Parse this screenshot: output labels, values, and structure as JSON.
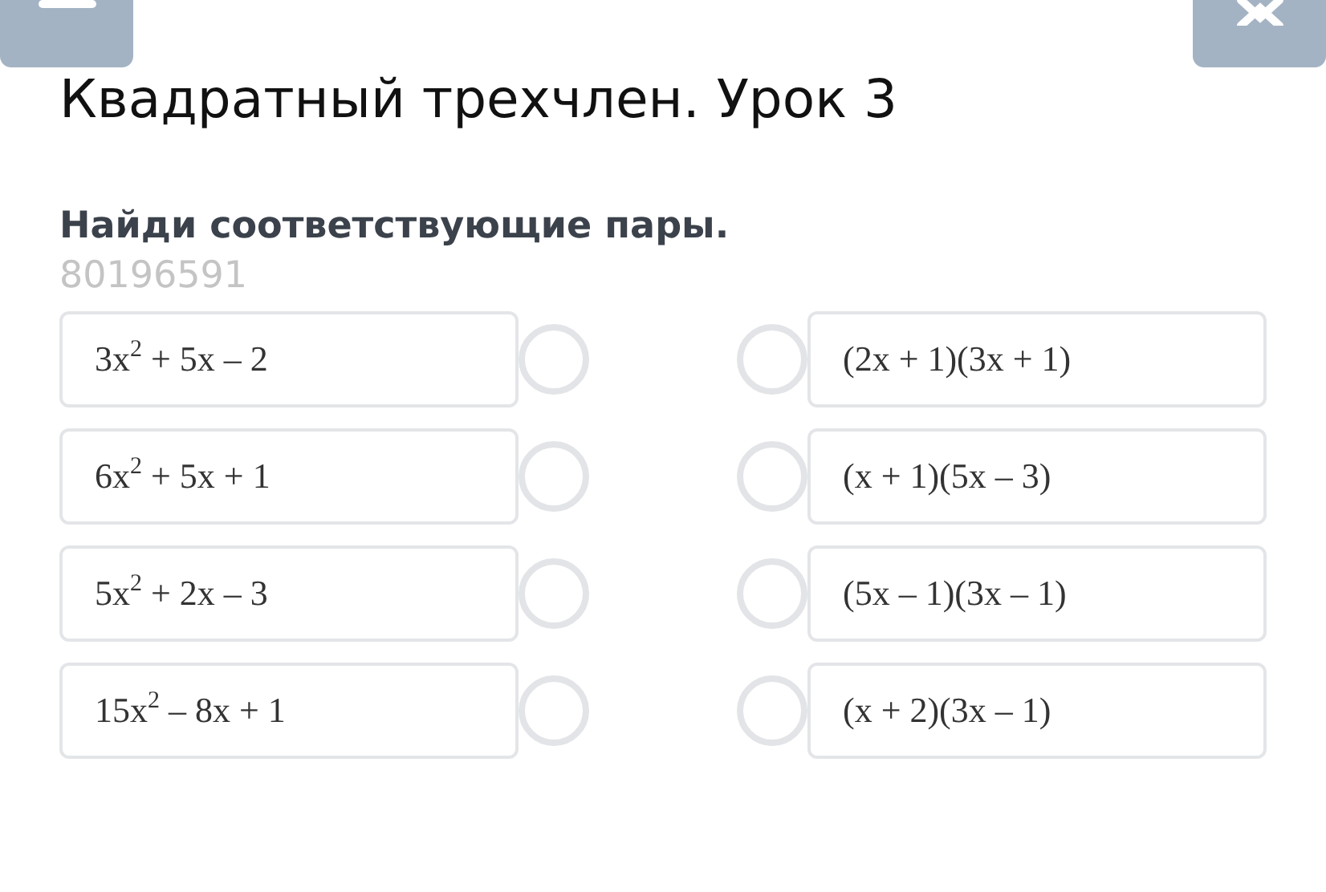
{
  "title": "Квадратный трехчлен. Урок 3",
  "task": {
    "prompt": "Найди соответствующие пары.",
    "code": "80196591"
  },
  "left_items": [
    {
      "text": "3x$^{2}$ + 5x – 2",
      "selected": false
    },
    {
      "text": "6x$^{2}$ + 5x + 1",
      "selected": false
    },
    {
      "text": "5x$^{2}$ + 2x – 3",
      "selected": false
    },
    {
      "text": "15x$^{2}$ – 8x + 1",
      "selected": false
    }
  ],
  "right_items": [
    {
      "text": "(2x + 1)(3x + 1)",
      "selected": false
    },
    {
      "text": "(x + 1)(5x – 3)",
      "selected": false
    },
    {
      "text": "(5x – 1)(3x – 1)",
      "selected": false
    },
    {
      "text": "(x + 2)(3x – 1)",
      "selected": false
    }
  ]
}
